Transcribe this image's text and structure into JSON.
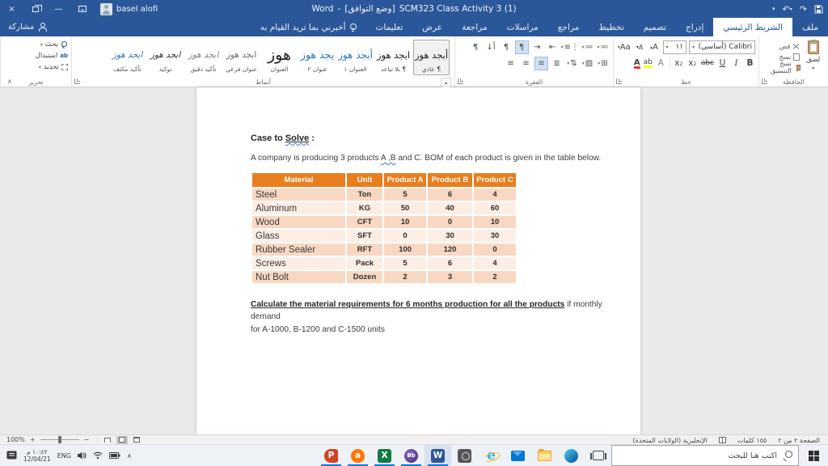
{
  "titlebar": {
    "app_name": "Word",
    "separator": "-",
    "compat_mode": "[وضع التوافق]",
    "doc_name": "SCM323 Class Activity 3 (1)",
    "user_name": "basel alofi",
    "icons": [
      "close-icon",
      "restore-icon",
      "minimize-icon",
      "ribbon-display-options-icon",
      "customize-quick-access-icon",
      "undo-icon",
      "redo-icon",
      "save-icon"
    ]
  },
  "tab_row": {
    "share_label": "مشاركة",
    "file_tab": "ملف",
    "tabs": [
      "الشريط الرئيسي",
      "إدراج",
      "تصميم",
      "تخطيط",
      "مراجع",
      "مراسلات",
      "مراجعة",
      "عرض",
      "تعليمات"
    ],
    "active_tab": "الشريط الرئيسي",
    "tell_me": "أخبرني بما تريد القيام به"
  },
  "ribbon": {
    "clipboard": {
      "group_label": "الحافظة",
      "paste_label": "لصق",
      "cut_label": "قص",
      "copy_label": "نسخ",
      "format_painter_label": "نسخ التنسيق"
    },
    "font": {
      "group_label": "خط",
      "font_name": "Calibri (أساسي)",
      "font_size": "١١"
    },
    "paragraph": {
      "group_label": "الفقرة"
    },
    "styles": {
      "group_label": "أنماط",
      "items": [
        {
          "preview": "أبجد هوز",
          "name": "¶ عادي"
        },
        {
          "preview": "ابجد هوز",
          "name": "¶ بلا تباعد"
        },
        {
          "preview": "أبجد هوز",
          "name": "العنوان ١"
        },
        {
          "preview": "يجد هوز",
          "name": "عنوان ٢"
        },
        {
          "preview": "هوز",
          "name": "العنوان"
        },
        {
          "preview": "ابجد هوز",
          "name": "عنوان فرعي"
        },
        {
          "preview": "ابجد هوز",
          "name": "تأكيد دقيق"
        },
        {
          "preview": "ابجد هوز",
          "name": "توكيد"
        },
        {
          "preview": "ابجد هوز",
          "name": "تأكيد مكثف"
        }
      ]
    },
    "editing": {
      "group_label": "تحرير",
      "find_label": "بحث",
      "replace_label": "استبدال",
      "select_label": "تحديد"
    }
  },
  "document": {
    "heading_prefix": "Case to ",
    "heading_underlined": "Solve",
    "heading_suffix": " :",
    "intro_pre": "A company is producing 3 products ",
    "intro_wavy": "A ,B",
    "intro_post": " and C. BOM of each product is given in the table below.",
    "table": {
      "headers": [
        "Material",
        "Unit",
        "Product A",
        "Product B",
        "Product C"
      ],
      "rows": [
        [
          "Steel",
          "Ton",
          "5",
          "6",
          "4"
        ],
        [
          "Aluminum",
          "KG",
          "50",
          "40",
          "60"
        ],
        [
          "Wood",
          "CFT",
          "10",
          "0",
          "10"
        ],
        [
          "Glass",
          "SFT",
          "0",
          "30",
          "30"
        ],
        [
          "Rubber Sealer",
          "RFT",
          "100",
          "120",
          "0"
        ],
        [
          "Screws",
          "Pack",
          "5",
          "6",
          "4"
        ],
        [
          "Nut Bolt",
          "Dozen",
          "2",
          "3",
          "2"
        ]
      ]
    },
    "question_bold": "Calculate the material requirements for 6 months production for all the products",
    "question_rest": " if monthly demand",
    "question_line2": "for A-1000, B-1200 and C-1500 units"
  },
  "status_bar": {
    "page_info": "الصفحة ٢ من ٢",
    "word_count": "١٥٥ كلمات",
    "language": "الإنجليزية (الولايات المتحدة)",
    "zoom_level": "100%"
  },
  "taskbar": {
    "search_placeholder": "اكتب هنا للبحث",
    "time": "١٠:٤٢ م",
    "date": "12/04/21",
    "language": "ENG",
    "apps": [
      {
        "name": "powerpoint",
        "glyph": "P",
        "running": true,
        "active": false
      },
      {
        "name": "avast",
        "glyph": "a",
        "running": true,
        "active": false
      },
      {
        "name": "excel",
        "glyph": "X",
        "running": true,
        "active": false
      },
      {
        "name": "blackboard",
        "glyph": "Bb",
        "running": true,
        "active": false
      },
      {
        "name": "word",
        "glyph": "W",
        "running": true,
        "active": true
      },
      {
        "name": "camera",
        "glyph": "",
        "running": false,
        "active": false
      },
      {
        "name": "internet-explorer",
        "glyph": "e",
        "running": false,
        "active": false
      },
      {
        "name": "mail",
        "glyph": "",
        "running": false,
        "active": false
      },
      {
        "name": "file-explorer",
        "glyph": "",
        "running": false,
        "active": false
      },
      {
        "name": "edge",
        "glyph": "",
        "running": false,
        "active": false
      },
      {
        "name": "task-view",
        "glyph": "",
        "running": false,
        "active": false
      }
    ]
  },
  "colors": {
    "accent_blue": "#2B579A",
    "table_header_orange": "#E87E1E",
    "table_row_dark": "#F8D8C3",
    "table_row_light": "#FCEEE5",
    "running_indicator": "#0078D7",
    "heading_style_blue": "#2E74B5",
    "squiggle_blue": "#4472C4"
  }
}
